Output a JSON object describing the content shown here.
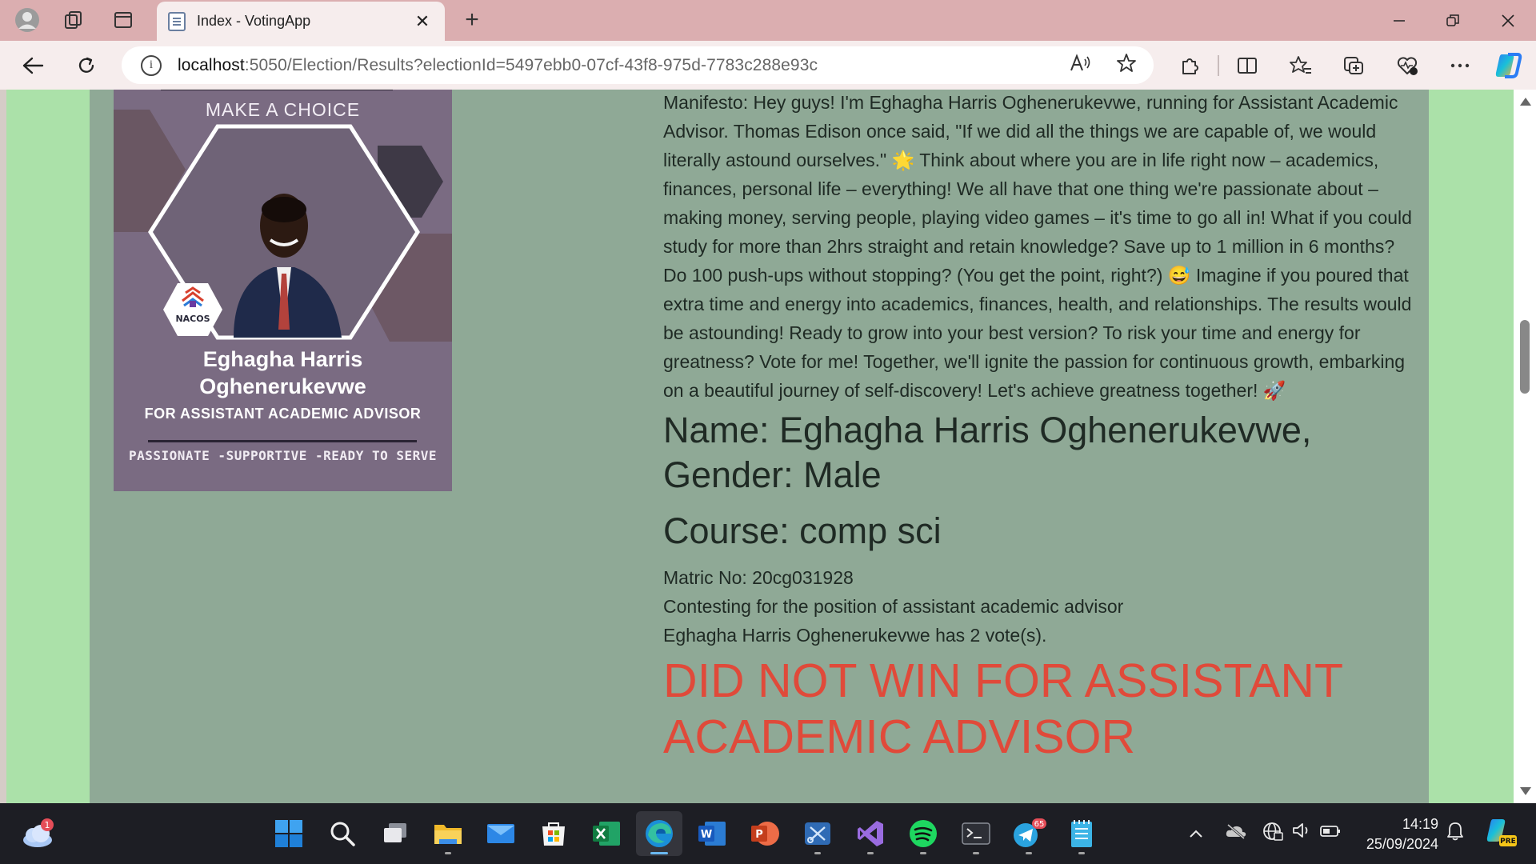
{
  "browser": {
    "tab_title": "Index - VotingApp",
    "url_host": "localhost",
    "url_rest": ":5050/Election/Results?electionId=5497ebb0-07cf-43f8-975d-7783c288e93c"
  },
  "poster": {
    "heading": "MAKE A CHOICE",
    "logo_text": "NACOS",
    "name_line1": "Eghagha Harris",
    "name_line2": "Oghenerukevwe",
    "role": "FOR ASSISTANT ACADEMIC ADVISOR",
    "tagline": "PASSIONATE -SUPPORTIVE -READY TO SERVE"
  },
  "candidate": {
    "manifesto": "Manifesto: Hey guys! I'm Eghagha Harris Oghenerukevwe, running for Assistant Academic Advisor. Thomas Edison once said, \"If we did all the things we are capable of, we would literally astound ourselves.\" 🌟 Think about where you are in life right now – academics, finances, personal life – everything! We all have that one thing we're passionate about – making money, serving people, playing video games – it's time to go all in! What if you could study for more than 2hrs straight and retain knowledge? Save up to 1 million in 6 months? Do 100 push-ups without stopping? (You get the point, right?) 😅 Imagine if you poured that extra time and energy into academics, finances, health, and relationships. The results would be astounding! Ready to grow into your best version? To risk your time and energy for greatness? Vote for me! Together, we'll ignite the passion for continuous growth, embarking on a beautiful journey of self-discovery! Let's achieve greatness together! 🚀",
    "name_gender": "Name: Eghagha Harris Oghenerukevwe, Gender: Male",
    "course": "Course: comp sci",
    "matric": "Matric No: 20cg031928",
    "position": "Contesting for the position of assistant academic advisor",
    "votes": "Eghagha Harris Oghenerukevwe has 2 vote(s).",
    "result": "DID NOT WIN FOR ASSISTANT ACADEMIC ADVISOR"
  },
  "taskbar": {
    "weather_badge": "1",
    "telegram_badge": "65",
    "time": "14:19",
    "date": "25/09/2024",
    "copilot_badge": "PRE"
  },
  "colors": {
    "page_bg": "#abe1a9",
    "content_bg": "#8fa996",
    "result_text": "#e04a3a",
    "tab_strip": "#dbaeb0"
  }
}
